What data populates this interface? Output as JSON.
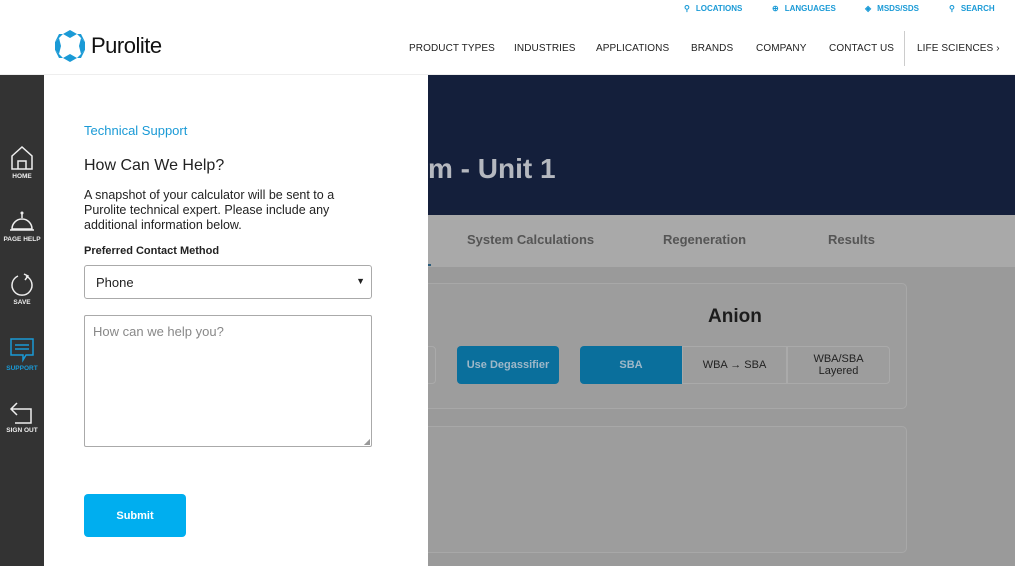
{
  "header": {
    "logo_text": "Purolite",
    "utility": [
      {
        "icon": "location-pin-icon",
        "label": "LOCATIONS"
      },
      {
        "icon": "globe-icon",
        "label": "LANGUAGES"
      },
      {
        "icon": "diamond-icon",
        "label": "MSDS/SDS"
      },
      {
        "icon": "search-icon",
        "label": "SEARCH"
      }
    ],
    "nav": [
      "PRODUCT TYPES",
      "INDUSTRIES",
      "APPLICATIONS",
      "BRANDS",
      "COMPANY",
      "CONTACT US",
      "LIFE SCIENCES ›"
    ]
  },
  "sidebar": {
    "items": [
      {
        "icon": "home-icon",
        "label": "HOME"
      },
      {
        "icon": "bell-icon",
        "label": "PAGE HELP"
      },
      {
        "icon": "refresh-icon",
        "label": "SAVE"
      },
      {
        "icon": "chat-icon",
        "label": "SUPPORT",
        "active": true
      },
      {
        "icon": "sign-out-icon",
        "label": "SIGN OUT"
      }
    ]
  },
  "support": {
    "kicker": "Technical Support",
    "title": "How Can We Help?",
    "description": "A snapshot of your calculator will be sent to a Purolite technical expert. Please include any additional information below.",
    "contact_label": "Preferred Contact Method",
    "contact_value": "Phone",
    "message_placeholder": "How can we help you?",
    "submit": "Submit"
  },
  "background": {
    "title": "m - Unit 1",
    "tabs": [
      "System Calculations",
      "Regeneration",
      "Results"
    ],
    "anion_title": "Anion",
    "degassifier": "Use Degassifier",
    "anion_options": [
      "SBA",
      "WBA → SBA",
      "WBA/SBA Layered"
    ],
    "anion_selected": "SBA"
  },
  "colors": {
    "accent": "#00aeef",
    "navy": "#141f3b",
    "sidebar": "#333333"
  }
}
